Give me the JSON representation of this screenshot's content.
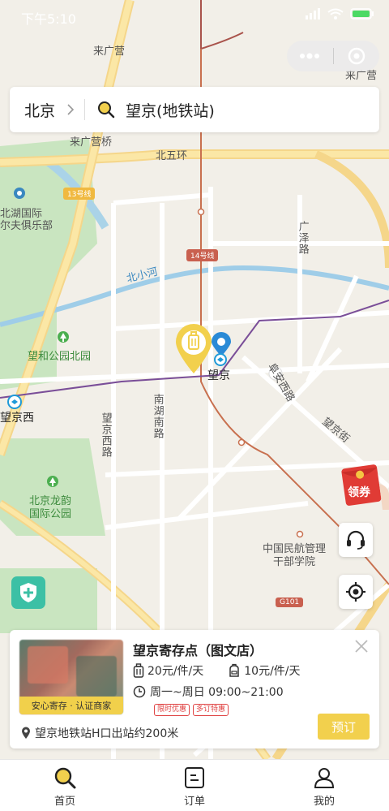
{
  "status_bar": {
    "time": "下午5:10"
  },
  "header": {
    "city": "北京",
    "search_value": "望京(地铁站)"
  },
  "map": {
    "labels": {
      "laiguangying": "来广营",
      "laiguangying_right": "来广营",
      "laiguangying_bridge": "来广营桥",
      "north_5th_ring": "北五环",
      "line13": "13号线",
      "line14": "14号线",
      "golf_club": "北湖国际\n尔夫俱乐部",
      "beixiaohe": "北小河",
      "guangze_road": "广泽路",
      "wanghe_park": "望和公园北园",
      "wangjing": "望京",
      "wangjing_west": "望京西",
      "nanhu_south_road": "南湖南路",
      "wangjing_west_road": "望京西路",
      "fuan_west_road": "阜安西路",
      "wangjing_street": "望京街",
      "longyun_park": "北京龙韵\n国际公园",
      "caac_college": "中国民航管理\n干部学院",
      "g101": "G101"
    }
  },
  "coupon": {
    "label": "领券"
  },
  "store": {
    "name": "望京寄存点（图文店）",
    "badge": "安心寄存 · 认证商家",
    "price_luggage": "20元/件/天",
    "price_bag": "10元/件/天",
    "hours": "周一~周日 09:00~21:00",
    "tags": [
      "限时优惠",
      "多订特惠"
    ],
    "book_label": "预订",
    "location": "望京地铁站H口出站约200米"
  },
  "tabs": [
    {
      "label": "首页",
      "icon": "search-icon"
    },
    {
      "label": "订单",
      "icon": "order-icon"
    },
    {
      "label": "我的",
      "icon": "user-icon"
    }
  ],
  "colors": {
    "accent": "#f2d04d",
    "pin_blue": "#2a8ad6",
    "teal": "#3cc0a5"
  }
}
